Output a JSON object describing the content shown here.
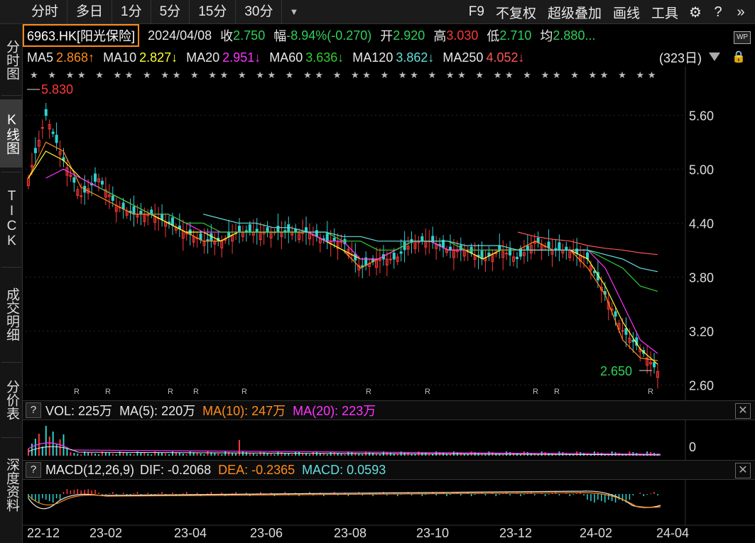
{
  "toolbar": {
    "timeframes": [
      "分时",
      "多日",
      "1分",
      "5分",
      "15分",
      "30分"
    ],
    "tools": [
      "F9",
      "不复权",
      "超级叠加",
      "画线",
      "工具"
    ]
  },
  "sidebar": [
    {
      "label": "分时图",
      "active": false
    },
    {
      "label": "K线图",
      "active": true
    },
    {
      "label": "TICK",
      "active": false
    },
    {
      "label": "成交明细",
      "active": false
    },
    {
      "label": "分价表",
      "active": false
    },
    {
      "label": "深度资料",
      "active": false
    }
  ],
  "info": {
    "code": "6963.HK[阳光保险]",
    "date": "2024/04/08",
    "close_label": "收",
    "close": "2.750",
    "change_label": "幅",
    "change": "-8.94%(-0.270)",
    "open_label": "开",
    "open": "2.920",
    "high_label": "高",
    "high": "3.030",
    "low_label": "低",
    "low": "2.710",
    "avg_label": "均",
    "avg": "2.880..."
  },
  "ma_legend": [
    {
      "name": "MA5",
      "value": "2.868↑",
      "color": "#ff8c1a"
    },
    {
      "name": "MA10",
      "value": "2.827↓",
      "color": "#ffff33"
    },
    {
      "name": "MA20",
      "value": "2.951↓",
      "color": "#ff33ff"
    },
    {
      "name": "MA60",
      "value": "3.636↓",
      "color": "#33cc33"
    },
    {
      "name": "MA120",
      "value": "3.862↓",
      "color": "#66dddd"
    },
    {
      "name": "MA250",
      "value": "4.052↓",
      "color": "#ff5555"
    }
  ],
  "days_label": "(323日)",
  "vol_legend": {
    "q": "?",
    "items": [
      {
        "text": "VOL: 225万",
        "color": "#e8e8e8"
      },
      {
        "text": "MA(5): 220万",
        "color": "#e8e8e8"
      },
      {
        "text": "MA(10): 247万",
        "color": "#ff8c1a"
      },
      {
        "text": "MA(20): 223万",
        "color": "#ff33ff"
      }
    ]
  },
  "macd_legend": {
    "q": "?",
    "items": [
      {
        "text": "MACD(12,26,9)",
        "color": "#e8e8e8"
      },
      {
        "text": "DIF: -0.2068",
        "color": "#e8e8e8"
      },
      {
        "text": "DEA: -0.2365",
        "color": "#ff8c1a"
      },
      {
        "text": "MACD: 0.0593",
        "color": "#66dddd"
      }
    ]
  },
  "chart_data": {
    "type": "candlestick",
    "ylim": [
      2.5,
      5.95
    ],
    "y_ticks": [
      "5.60",
      "5.00",
      "4.40",
      "3.80",
      "3.20",
      "2.60"
    ],
    "x_labels": [
      "22-12",
      "23-02",
      "23-04",
      "23-06",
      "23-08",
      "23-10",
      "23-12",
      "24-02",
      "24-04"
    ],
    "vol_tick": "0",
    "max_marker": "5.830",
    "min_marker": "2.650",
    "series": [
      {
        "name": "close",
        "values": [
          4.9,
          5.6,
          5.1,
          4.7,
          4.9,
          4.6,
          4.5,
          4.5,
          4.4,
          4.3,
          4.2,
          4.2,
          4.3,
          4.3,
          4.3,
          4.3,
          4.3,
          4.2,
          4.2,
          3.9,
          4.0,
          4.0,
          4.2,
          4.2,
          4.1,
          4.1,
          4.0,
          4.1,
          4.0,
          4.2,
          4.1,
          4.1,
          4.0,
          3.6,
          3.2,
          3.0,
          2.75
        ]
      },
      {
        "name": "MA5",
        "values": [
          4.9,
          5.3,
          5.2,
          4.8,
          4.7,
          4.6,
          4.5,
          4.5,
          4.4,
          4.3,
          4.2,
          4.2,
          4.3,
          4.3,
          4.3,
          4.3,
          4.3,
          4.2,
          4.1,
          3.9,
          4.0,
          4.1,
          4.2,
          4.2,
          4.1,
          4.1,
          4.0,
          4.1,
          4.1,
          4.2,
          4.1,
          4.1,
          3.9,
          3.6,
          3.1,
          2.9,
          2.87
        ]
      },
      {
        "name": "MA10",
        "values": [
          4.9,
          5.2,
          5.1,
          4.9,
          4.8,
          4.7,
          4.6,
          4.5,
          4.4,
          4.3,
          4.3,
          4.2,
          4.3,
          4.3,
          4.3,
          4.3,
          4.3,
          4.2,
          4.1,
          4.0,
          4.0,
          4.1,
          4.2,
          4.2,
          4.1,
          4.1,
          4.0,
          4.1,
          4.1,
          4.1,
          4.1,
          4.1,
          4.0,
          3.7,
          3.3,
          3.0,
          2.83
        ]
      },
      {
        "name": "MA20",
        "values": [
          null,
          4.9,
          5.0,
          4.9,
          4.8,
          4.7,
          4.6,
          4.5,
          4.5,
          4.4,
          4.3,
          4.3,
          4.3,
          4.3,
          4.3,
          4.3,
          4.3,
          4.2,
          4.2,
          4.0,
          4.0,
          4.1,
          4.2,
          4.2,
          4.1,
          4.1,
          4.1,
          4.1,
          4.1,
          4.1,
          4.1,
          4.1,
          4.1,
          3.9,
          3.5,
          3.1,
          2.95
        ]
      },
      {
        "name": "MA60",
        "values": [
          null,
          null,
          null,
          null,
          4.8,
          4.7,
          4.6,
          4.5,
          4.5,
          4.4,
          4.4,
          4.3,
          4.3,
          4.3,
          4.3,
          4.3,
          4.3,
          4.3,
          4.2,
          4.2,
          4.1,
          4.1,
          4.2,
          4.2,
          4.2,
          4.1,
          4.1,
          4.1,
          4.1,
          4.1,
          4.1,
          4.1,
          4.1,
          4.0,
          3.9,
          3.7,
          3.64
        ]
      },
      {
        "name": "MA120",
        "values": [
          null,
          null,
          null,
          null,
          null,
          null,
          null,
          null,
          null,
          null,
          4.5,
          4.45,
          4.4,
          4.4,
          4.35,
          4.35,
          4.3,
          4.3,
          4.25,
          4.25,
          4.2,
          4.2,
          4.2,
          4.2,
          4.2,
          4.15,
          4.15,
          4.15,
          4.1,
          4.1,
          4.1,
          4.1,
          4.1,
          4.05,
          4.0,
          3.9,
          3.86
        ]
      },
      {
        "name": "MA250",
        "values": [
          null,
          null,
          null,
          null,
          null,
          null,
          null,
          null,
          null,
          null,
          null,
          null,
          null,
          null,
          null,
          null,
          null,
          null,
          null,
          null,
          null,
          null,
          null,
          null,
          null,
          null,
          null,
          null,
          4.3,
          4.25,
          4.22,
          4.2,
          4.15,
          4.12,
          4.1,
          4.07,
          4.05
        ]
      }
    ]
  }
}
